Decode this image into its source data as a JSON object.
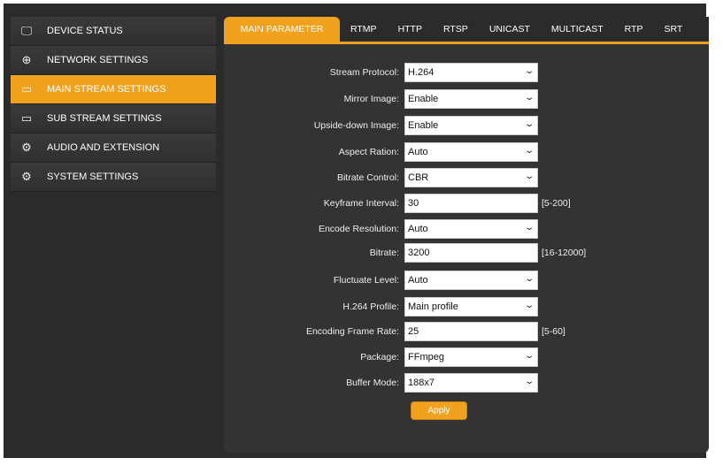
{
  "sidebar": {
    "items": [
      {
        "label": "DEVICE STATUS",
        "icon": "monitor-icon"
      },
      {
        "label": "NETWORK SETTINGS",
        "icon": "globe-icon"
      },
      {
        "label": "MAIN STREAM SETTINGS",
        "icon": "stream-icon"
      },
      {
        "label": "SUB STREAM SETTINGS",
        "icon": "stream-icon"
      },
      {
        "label": "AUDIO AND EXTENSION",
        "icon": "dotted-gear-icon"
      },
      {
        "label": "SYSTEM SETTINGS",
        "icon": "gear-icon"
      }
    ]
  },
  "tabs": [
    "MAIN PARAMETER",
    "RTMP",
    "HTTP",
    "RTSP",
    "UNICAST",
    "MULTICAST",
    "RTP",
    "SRT"
  ],
  "form": {
    "stream_protocol": {
      "label": "Stream Protocol:",
      "value": "H.264"
    },
    "mirror": {
      "label": "Mirror Image:",
      "value": "Enable"
    },
    "upside_down": {
      "label": "Upside-down Image:",
      "value": "Enable"
    },
    "aspect": {
      "label": "Aspect Ration:",
      "value": "Auto"
    },
    "bitrate_control": {
      "label": "Bitrate Control:",
      "value": "CBR"
    },
    "keyframe": {
      "label": "Keyframe Interval:",
      "value": "30",
      "range": "[5-200]"
    },
    "resolution": {
      "label": "Encode Resolution:",
      "value": "Auto"
    },
    "bitrate": {
      "label": "Bitrate:",
      "value": "3200",
      "range": "[16-12000]"
    },
    "fluctuate": {
      "label": "Fluctuate Level:",
      "value": "Auto"
    },
    "profile": {
      "label": "H.264 Profile:",
      "value": "Main profile"
    },
    "framerate": {
      "label": "Encoding Frame Rate:",
      "value": "25",
      "range": "[5-60]"
    },
    "package": {
      "label": "Package:",
      "value": "FFmpeg"
    },
    "buffer": {
      "label": "Buffer Mode:",
      "value": "188x7"
    },
    "apply": "Apply"
  },
  "colors": {
    "accent": "#f0a21e",
    "bg": "#2b2b2b"
  }
}
